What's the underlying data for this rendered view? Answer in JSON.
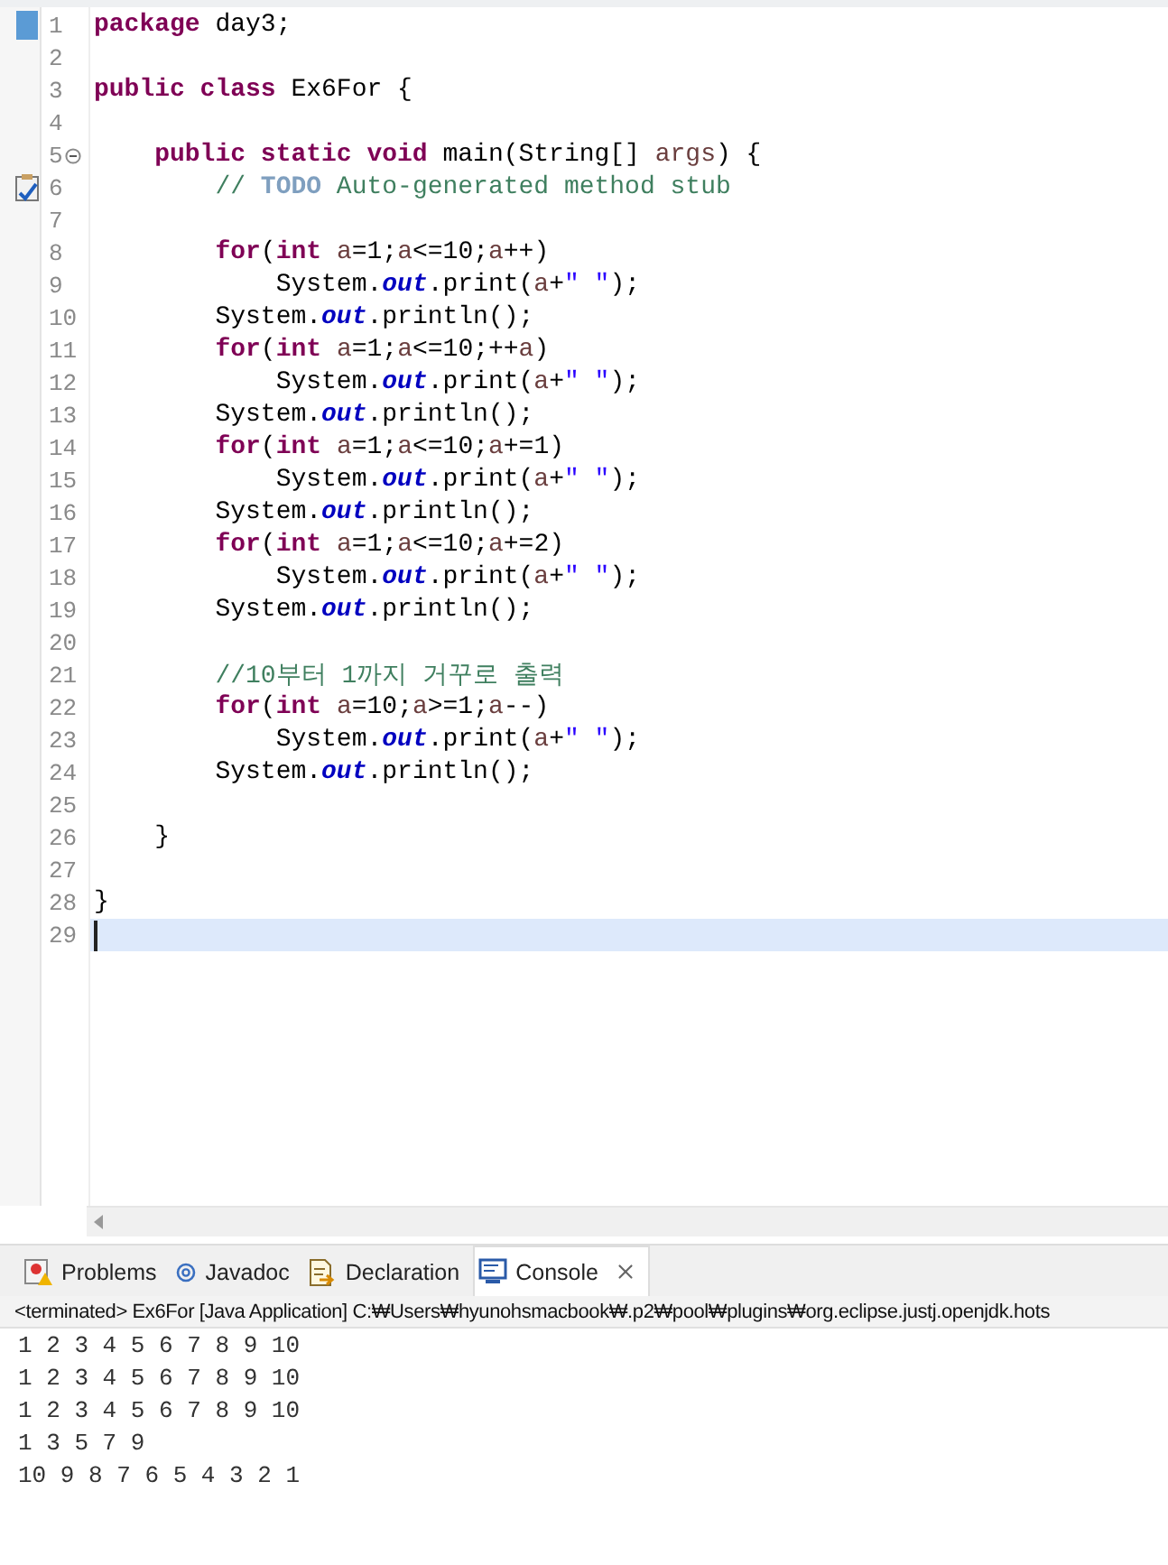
{
  "editor": {
    "lines": [
      {
        "number": "1",
        "current": false,
        "kind": "bookmark",
        "tokens": [
          {
            "kind": "kw",
            "text": "package"
          },
          {
            "kind": "text",
            "text": " day3;"
          }
        ]
      },
      {
        "number": "2",
        "current": false
      },
      {
        "number": "3",
        "current": false,
        "tokens": [
          {
            "kind": "kw",
            "text": "public class"
          },
          {
            "kind": "text",
            "text": " Ex6For {"
          }
        ]
      },
      {
        "number": "4",
        "current": false
      },
      {
        "number": "5",
        "current": false,
        "kind": "fold",
        "tokens": [
          {
            "kind": "kw",
            "text": "    public static void"
          },
          {
            "kind": "text",
            "text": " main(String[] "
          },
          {
            "kind": "var",
            "text": "args"
          },
          {
            "kind": "text",
            "text": ") {"
          }
        ]
      },
      {
        "number": "6",
        "current": false,
        "kind": "task",
        "tokens": [
          {
            "kind": "comment",
            "text": "        // "
          },
          {
            "kind": "task",
            "text": "TODO"
          },
          {
            "kind": "comment",
            "text": " Auto-generated method stub"
          }
        ]
      },
      {
        "number": "7",
        "current": false
      },
      {
        "number": "8",
        "current": false,
        "tokens": [
          {
            "kind": "kw",
            "text": "        for"
          },
          {
            "kind": "text",
            "text": "("
          },
          {
            "kind": "kw",
            "text": "int"
          },
          {
            "kind": "var",
            "text": " a"
          },
          {
            "kind": "text",
            "text": "=1;"
          },
          {
            "kind": "var",
            "text": "a"
          },
          {
            "kind": "text",
            "text": "<=10;"
          },
          {
            "kind": "var",
            "text": "a"
          },
          {
            "kind": "text",
            "text": "++)"
          }
        ]
      },
      {
        "number": "9",
        "current": false,
        "tokens": [
          {
            "kind": "text",
            "text": "            System."
          },
          {
            "kind": "field",
            "text": "out"
          },
          {
            "kind": "text",
            "text": ".print("
          },
          {
            "kind": "var",
            "text": "a"
          },
          {
            "kind": "text",
            "text": "+"
          },
          {
            "kind": "str",
            "text": "\" \""
          },
          {
            "kind": "text",
            "text": ");"
          }
        ]
      },
      {
        "number": "10",
        "current": false,
        "tokens": [
          {
            "kind": "text",
            "text": "        System."
          },
          {
            "kind": "field",
            "text": "out"
          },
          {
            "kind": "text",
            "text": ".println();"
          }
        ]
      },
      {
        "number": "11",
        "current": false,
        "tokens": [
          {
            "kind": "kw",
            "text": "        for"
          },
          {
            "kind": "text",
            "text": "("
          },
          {
            "kind": "kw",
            "text": "int"
          },
          {
            "kind": "var",
            "text": " a"
          },
          {
            "kind": "text",
            "text": "=1;"
          },
          {
            "kind": "var",
            "text": "a"
          },
          {
            "kind": "text",
            "text": "<=10;++"
          },
          {
            "kind": "var",
            "text": "a"
          },
          {
            "kind": "text",
            "text": ")"
          }
        ]
      },
      {
        "number": "12",
        "current": false,
        "tokens": [
          {
            "kind": "text",
            "text": "            System."
          },
          {
            "kind": "field",
            "text": "out"
          },
          {
            "kind": "text",
            "text": ".print("
          },
          {
            "kind": "var",
            "text": "a"
          },
          {
            "kind": "text",
            "text": "+"
          },
          {
            "kind": "str",
            "text": "\" \""
          },
          {
            "kind": "text",
            "text": ");"
          }
        ]
      },
      {
        "number": "13",
        "current": false,
        "tokens": [
          {
            "kind": "text",
            "text": "        System."
          },
          {
            "kind": "field",
            "text": "out"
          },
          {
            "kind": "text",
            "text": ".println();"
          }
        ]
      },
      {
        "number": "14",
        "current": false,
        "tokens": [
          {
            "kind": "kw",
            "text": "        for"
          },
          {
            "kind": "text",
            "text": "("
          },
          {
            "kind": "kw",
            "text": "int"
          },
          {
            "kind": "var",
            "text": " a"
          },
          {
            "kind": "text",
            "text": "=1;"
          },
          {
            "kind": "var",
            "text": "a"
          },
          {
            "kind": "text",
            "text": "<=10;"
          },
          {
            "kind": "var",
            "text": "a"
          },
          {
            "kind": "text",
            "text": "+=1)"
          }
        ]
      },
      {
        "number": "15",
        "current": false,
        "tokens": [
          {
            "kind": "text",
            "text": "            System."
          },
          {
            "kind": "field",
            "text": "out"
          },
          {
            "kind": "text",
            "text": ".print("
          },
          {
            "kind": "var",
            "text": "a"
          },
          {
            "kind": "text",
            "text": "+"
          },
          {
            "kind": "str",
            "text": "\" \""
          },
          {
            "kind": "text",
            "text": ");"
          }
        ]
      },
      {
        "number": "16",
        "current": false,
        "tokens": [
          {
            "kind": "text",
            "text": "        System."
          },
          {
            "kind": "field",
            "text": "out"
          },
          {
            "kind": "text",
            "text": ".println();"
          }
        ]
      },
      {
        "number": "17",
        "current": false,
        "tokens": [
          {
            "kind": "kw",
            "text": "        for"
          },
          {
            "kind": "text",
            "text": "("
          },
          {
            "kind": "kw",
            "text": "int"
          },
          {
            "kind": "var",
            "text": " a"
          },
          {
            "kind": "text",
            "text": "=1;"
          },
          {
            "kind": "var",
            "text": "a"
          },
          {
            "kind": "text",
            "text": "<=10;"
          },
          {
            "kind": "var",
            "text": "a"
          },
          {
            "kind": "text",
            "text": "+=2)"
          }
        ]
      },
      {
        "number": "18",
        "current": false,
        "tokens": [
          {
            "kind": "text",
            "text": "            System."
          },
          {
            "kind": "field",
            "text": "out"
          },
          {
            "kind": "text",
            "text": ".print("
          },
          {
            "kind": "var",
            "text": "a"
          },
          {
            "kind": "text",
            "text": "+"
          },
          {
            "kind": "str",
            "text": "\" \""
          },
          {
            "kind": "text",
            "text": ");"
          }
        ]
      },
      {
        "number": "19",
        "current": false,
        "tokens": [
          {
            "kind": "text",
            "text": "        System."
          },
          {
            "kind": "field",
            "text": "out"
          },
          {
            "kind": "text",
            "text": ".println();"
          }
        ]
      },
      {
        "number": "20",
        "current": false
      },
      {
        "number": "21",
        "current": false,
        "tokens": [
          {
            "kind": "comment",
            "text": "        //10부터 1까지 거꾸로 출력"
          }
        ]
      },
      {
        "number": "22",
        "current": false,
        "tokens": [
          {
            "kind": "kw",
            "text": "        for"
          },
          {
            "kind": "text",
            "text": "("
          },
          {
            "kind": "kw",
            "text": "int"
          },
          {
            "kind": "var",
            "text": " a"
          },
          {
            "kind": "text",
            "text": "=10;"
          },
          {
            "kind": "var",
            "text": "a"
          },
          {
            "kind": "text",
            "text": ">=1;"
          },
          {
            "kind": "var",
            "text": "a"
          },
          {
            "kind": "text",
            "text": "--)"
          }
        ]
      },
      {
        "number": "23",
        "current": false,
        "tokens": [
          {
            "kind": "text",
            "text": "            System."
          },
          {
            "kind": "field",
            "text": "out"
          },
          {
            "kind": "text",
            "text": ".print("
          },
          {
            "kind": "var",
            "text": "a"
          },
          {
            "kind": "text",
            "text": "+"
          },
          {
            "kind": "str",
            "text": "\" \""
          },
          {
            "kind": "text",
            "text": ");"
          }
        ]
      },
      {
        "number": "24",
        "current": false,
        "tokens": [
          {
            "kind": "text",
            "text": "        System."
          },
          {
            "kind": "field",
            "text": "out"
          },
          {
            "kind": "text",
            "text": ".println();"
          }
        ]
      },
      {
        "number": "25",
        "current": false
      },
      {
        "number": "26",
        "current": false,
        "tokens": [
          {
            "kind": "text",
            "text": "    }"
          }
        ]
      },
      {
        "number": "27",
        "current": false
      },
      {
        "number": "28",
        "current": false,
        "tokens": [
          {
            "kind": "text",
            "text": "}"
          }
        ]
      },
      {
        "number": "29",
        "current": true
      }
    ]
  },
  "views": {
    "tabs": [
      {
        "label": "Problems",
        "kind": "problems",
        "selected": false
      },
      {
        "label": "Javadoc",
        "kind": "javadoc",
        "selected": false
      },
      {
        "label": "Declaration",
        "kind": "declaration",
        "selected": false
      },
      {
        "label": "Console",
        "kind": "console",
        "selected": true
      }
    ]
  },
  "console": {
    "header": "<terminated> Ex6For [Java Application] C:₩Users₩hyunohsmacbook₩.p2₩pool₩plugins₩org.eclipse.justj.openjdk.hots",
    "output": [
      "1 2 3 4 5 6 7 8 9 10",
      "1 2 3 4 5 6 7 8 9 10",
      "1 2 3 4 5 6 7 8 9 10",
      "1 3 5 7 9",
      "10 9 8 7 6 5 4 3 2 1"
    ]
  }
}
